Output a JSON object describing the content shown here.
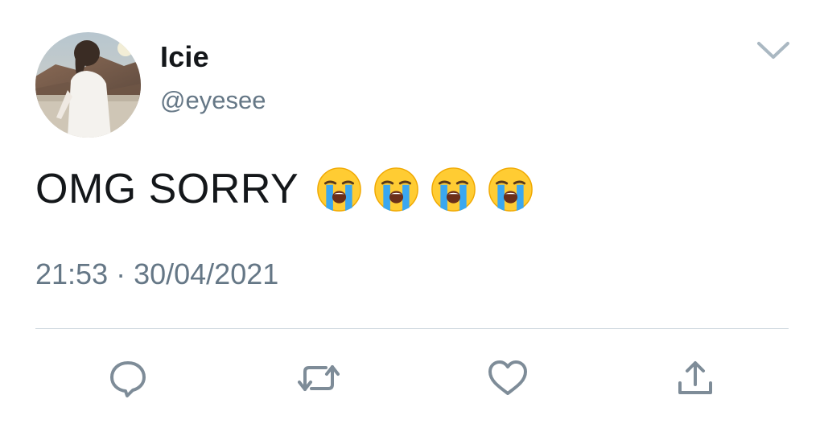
{
  "user": {
    "display_name": "Icie",
    "handle": "@eyesee",
    "avatar_icon": "profile-photo"
  },
  "tweet": {
    "text": "OMG SORRY",
    "emoji": [
      "loudly-crying-face",
      "loudly-crying-face",
      "loudly-crying-face",
      "loudly-crying-face"
    ],
    "timestamp": "21:53 · 30/04/2021"
  },
  "actions": {
    "reply_icon": "reply-icon",
    "retweet_icon": "retweet-icon",
    "like_icon": "heart-icon",
    "share_icon": "share-icon"
  },
  "colors": {
    "text_primary": "#14171a",
    "text_secondary": "#657786",
    "icon": "#7e8c98",
    "divider": "#ccd6dd"
  }
}
